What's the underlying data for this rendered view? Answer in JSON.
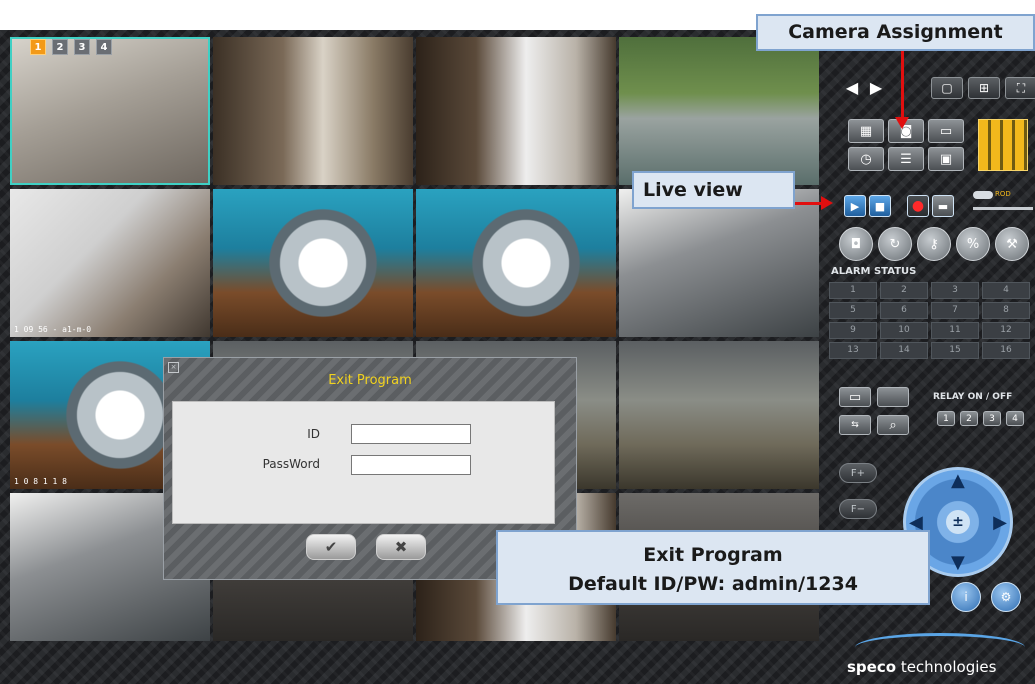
{
  "pages": [
    "1",
    "2",
    "3",
    "4"
  ],
  "cameras": [
    {
      "timestamp": ""
    },
    {
      "timestamp": ""
    },
    {
      "timestamp": ""
    },
    {
      "timestamp": ""
    },
    {
      "timestamp": "1 09 56 - a1-m-0"
    },
    {
      "timestamp": ""
    },
    {
      "timestamp": ""
    },
    {
      "timestamp": ""
    },
    {
      "timestamp": "1 0 8 1 1 8"
    },
    {
      "timestamp": ""
    },
    {
      "timestamp": ""
    },
    {
      "timestamp": ""
    },
    {
      "timestamp": ""
    },
    {
      "timestamp": ""
    },
    {
      "timestamp": ""
    },
    {
      "timestamp": ""
    }
  ],
  "panel": {
    "alarm_status_label": "ALARM STATUS",
    "alarm_numbers": [
      "1",
      "2",
      "3",
      "4",
      "5",
      "6",
      "7",
      "8",
      "9",
      "10",
      "11",
      "12",
      "13",
      "14",
      "15",
      "16"
    ],
    "relay_label": "RELAY ON / OFF",
    "relay_buttons": [
      "1",
      "2",
      "3",
      "4"
    ],
    "speed_label": "ROD",
    "brand": {
      "bold": "speco",
      "rest": " technologies"
    }
  },
  "dialog": {
    "title": "Exit Program",
    "id_label": "ID",
    "password_label": "PassWord",
    "id_value": "",
    "password_value": "",
    "ok_symbol": "✔",
    "cancel_symbol": "✖"
  },
  "callouts": {
    "camera_assignment": "Camera Assignment",
    "live_view": "Live view",
    "exit_line1": "Exit Program",
    "exit_line2": "Default ID/PW: admin/1234"
  },
  "colors": {
    "accent_orange": "#f39a18",
    "selection_teal": "#3fd0c4",
    "dialog_title_yellow": "#f1d21f",
    "callout_fill": "#dce6f2",
    "arrow_red": "#e10f0f"
  }
}
